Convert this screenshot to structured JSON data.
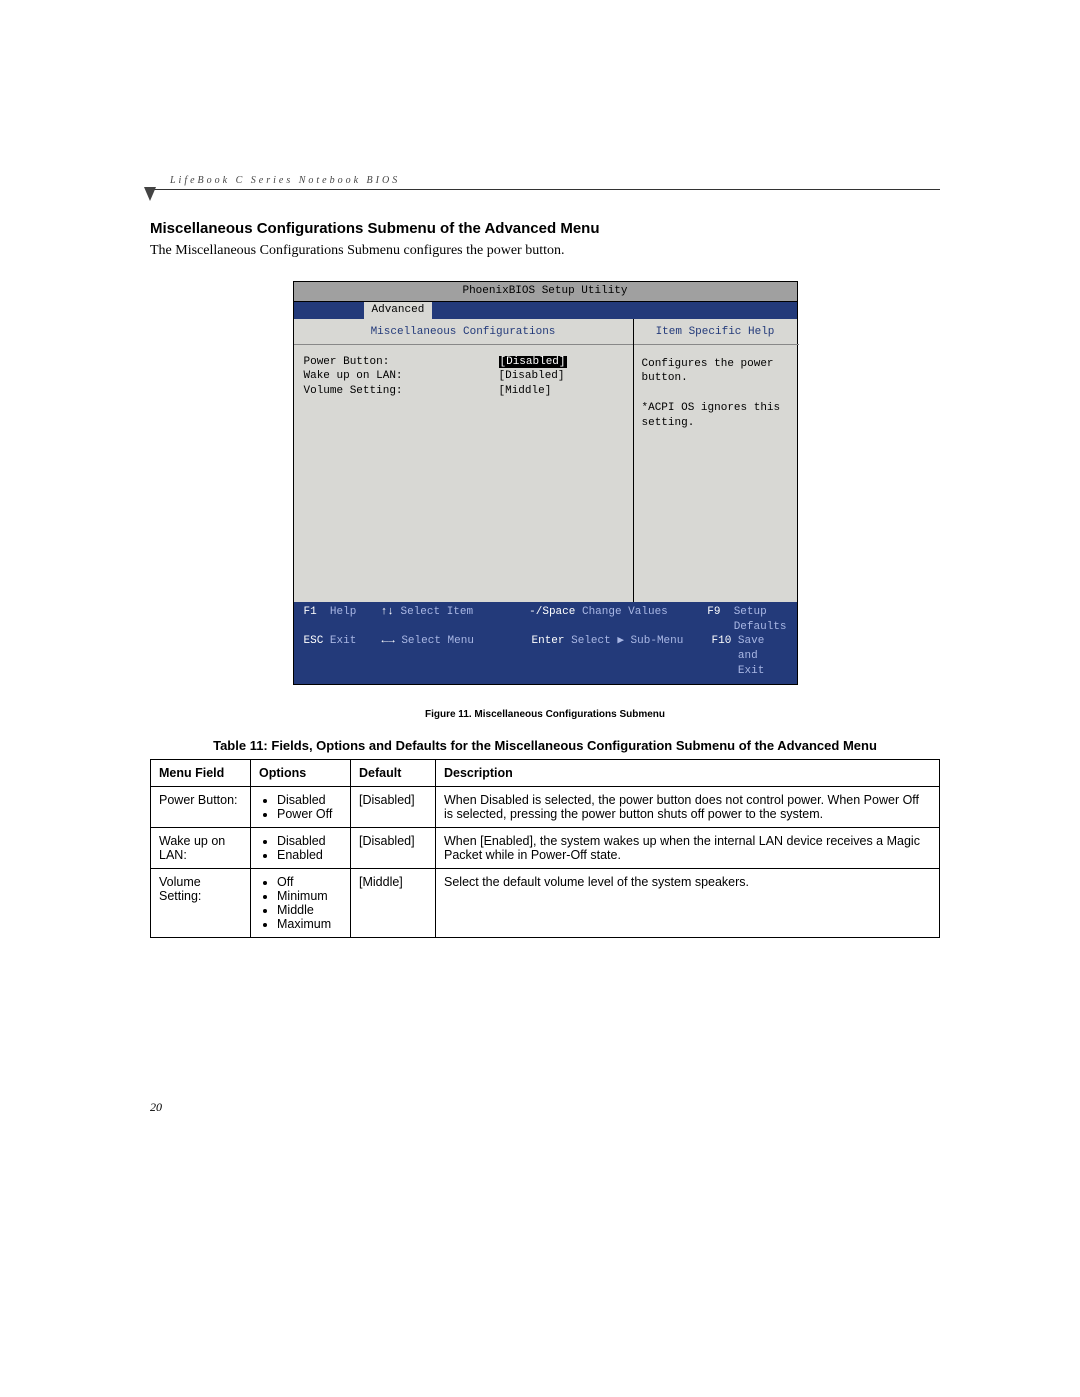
{
  "running_head": "LifeBook C Series Notebook BIOS",
  "section_title": "Miscellaneous Configurations Submenu of the Advanced Menu",
  "section_desc": "The Miscellaneous Configurations Submenu configures the power button.",
  "bios": {
    "title": "PhoenixBIOS Setup Utility",
    "active_tab": "Advanced",
    "submenu_title": "Miscellaneous Configurations",
    "help_title": "Item Specific Help",
    "fields": [
      {
        "label": "Power Button:",
        "value": "[Disabled]",
        "selected": true
      },
      {
        "label": "Wake up on LAN:",
        "value": "[Disabled]",
        "selected": false
      },
      {
        "label": "Volume Setting:",
        "value": "[Middle]",
        "selected": false
      }
    ],
    "help_text": "Configures the power button.\n\n*ACPI OS ignores this setting.",
    "footer": {
      "r1c1_key": "F1",
      "r1c1_lbl": "Help",
      "r1c2_key": "↑↓",
      "r1c2_lbl": "Select Item",
      "r1c3_key": "-/Space",
      "r1c3_lbl": "Change Values",
      "r1c4_key": "F9",
      "r1c4_lbl": "Setup Defaults",
      "r2c1_key": "ESC",
      "r2c1_lbl": "Exit",
      "r2c2_key": "←→",
      "r2c2_lbl": "Select Menu",
      "r2c3_key": "Enter",
      "r2c3_lbl": "Select ▶ Sub-Menu",
      "r2c4_key": "F10",
      "r2c4_lbl": "Save and Exit"
    }
  },
  "figure_caption": "Figure 11.  Miscellaneous Configurations Submenu",
  "table_caption": "Table 11: Fields, Options and Defaults for the Miscellaneous Configuration Submenu of the Advanced Menu",
  "table": {
    "headers": [
      "Menu Field",
      "Options",
      "Default",
      "Description"
    ],
    "rows": [
      {
        "field": "Power Button:",
        "options": [
          "Disabled",
          "Power Off"
        ],
        "default": "[Disabled]",
        "description": "When Disabled is selected, the power button does not control power. When Power Off is selected, pressing the power button shuts off power to the system."
      },
      {
        "field": "Wake up on LAN:",
        "options": [
          "Disabled",
          "Enabled"
        ],
        "default": "[Disabled]",
        "description": "When [Enabled], the system wakes up when the internal LAN device receives a Magic Packet while in Power-Off state."
      },
      {
        "field": "Volume Setting:",
        "options": [
          "Off",
          "Minimum",
          "Middle",
          "Maximum"
        ],
        "default": "[Middle]",
        "description": "Select the default volume level of the system speakers."
      }
    ]
  },
  "page_number": "20"
}
